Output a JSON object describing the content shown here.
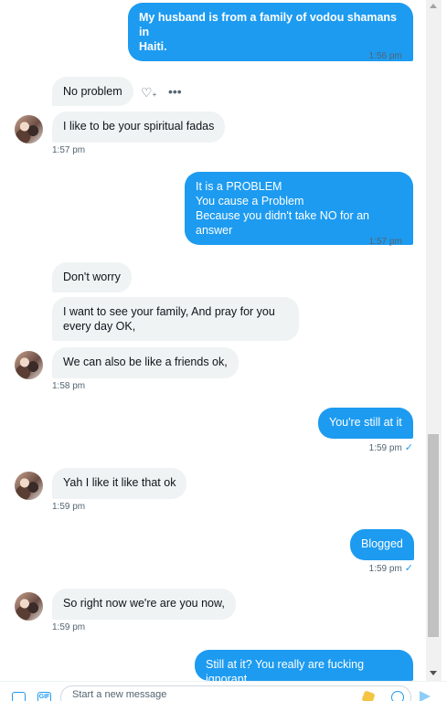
{
  "messages": [
    {
      "dir": "out",
      "lines": [
        "My husband is from a family of vodou shamans in",
        "Haiti."
      ]
    },
    {
      "dir": "in",
      "lines": [
        "No problem"
      ]
    },
    {
      "dir": "in",
      "lines": [
        "I like to be your spiritual fadas"
      ]
    },
    {
      "dir": "out",
      "lines": [
        "It is a PROBLEM",
        "You cause a Problem",
        "Because you didn't take NO for an answer"
      ]
    },
    {
      "dir": "in",
      "lines": [
        "Don't worry"
      ]
    },
    {
      "dir": "in",
      "lines": [
        "I want to see your family, And pray for you",
        "every day OK,"
      ]
    },
    {
      "dir": "in",
      "lines": [
        "We can also be like a friends ok,"
      ]
    },
    {
      "dir": "out",
      "lines": [
        "You're still at it"
      ]
    },
    {
      "dir": "in",
      "lines": [
        "Yah I like it like that ok"
      ]
    },
    {
      "dir": "out",
      "lines": [
        "Blogged"
      ]
    },
    {
      "dir": "in",
      "lines": [
        "So right now we're are you now,"
      ]
    },
    {
      "dir": "out",
      "lines": [
        "Still at it? You really are fucking ignorant"
      ]
    }
  ],
  "timestamps": {
    "t1": "1:56 pm",
    "t2": "1:57 pm",
    "t3": "1:57 pm",
    "t4": "1:58 pm",
    "t5": "1:59 pm",
    "t6": "1:59 pm",
    "t7": "1:59 pm",
    "t8": "1:59 pm"
  },
  "read_mark": "✓",
  "composer": {
    "placeholder": "Start a new message",
    "gif_label": "GIF"
  },
  "colors": {
    "outgoing": "#1d9bf0",
    "incoming": "#eff3f4",
    "timestamp": "#536471"
  },
  "icons": [
    "image-icon",
    "gif-icon",
    "emoji-icon",
    "send-icon",
    "react-heart-icon",
    "more-icon"
  ]
}
